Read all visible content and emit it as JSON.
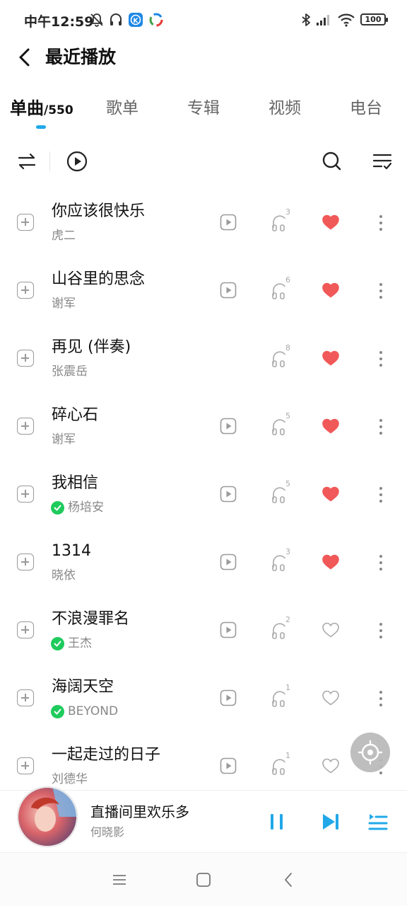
{
  "status_bar": {
    "time": "中午12:59",
    "battery": "100",
    "icons": [
      "mute-icon",
      "headset-icon",
      "kugou-icon",
      "app-icon",
      "bluetooth-icon",
      "signal-icon",
      "wifi-icon",
      "battery-icon"
    ]
  },
  "header": {
    "title": "最近播放"
  },
  "tabs": [
    {
      "label": "单曲",
      "count": "/550",
      "active": true
    },
    {
      "label": "歌单"
    },
    {
      "label": "专辑"
    },
    {
      "label": "视频"
    },
    {
      "label": "电台"
    }
  ],
  "toolbar": {
    "icons": [
      "sort-icon",
      "play-all-icon",
      "search-icon",
      "multi-select-icon"
    ]
  },
  "songs": [
    {
      "title": "你应该很快乐",
      "artist": "虎二",
      "verified": false,
      "has_mv": true,
      "quality": "3",
      "liked": true
    },
    {
      "title": "山谷里的思念",
      "artist": "谢军",
      "verified": false,
      "has_mv": true,
      "quality": "6",
      "liked": true
    },
    {
      "title": "再见 (伴奏)",
      "artist": "张震岳",
      "verified": false,
      "has_mv": false,
      "quality": "8",
      "liked": true
    },
    {
      "title": "碎心石",
      "artist": "谢军",
      "verified": false,
      "has_mv": true,
      "quality": "5",
      "liked": true
    },
    {
      "title": "我相信",
      "artist": "杨培安",
      "verified": true,
      "has_mv": true,
      "quality": "5",
      "liked": true
    },
    {
      "title": "1314",
      "artist": "晓依",
      "verified": false,
      "has_mv": true,
      "quality": "3",
      "liked": true
    },
    {
      "title": "不浪漫罪名",
      "artist": "王杰",
      "verified": true,
      "has_mv": true,
      "quality": "2",
      "liked": false
    },
    {
      "title": "海阔天空",
      "artist": "BEYOND",
      "verified": true,
      "has_mv": true,
      "quality": "1",
      "liked": false
    },
    {
      "title": "一起走过的日子",
      "artist": "刘德华",
      "verified": false,
      "has_mv": true,
      "quality": "1",
      "liked": false
    }
  ],
  "now_playing": {
    "title": "直播间里欢乐多",
    "artist": "何晓影"
  },
  "colors": {
    "accent": "#21a8e8",
    "liked": "#f15858",
    "verified": "#1ecb5c",
    "muted": "#999999"
  }
}
